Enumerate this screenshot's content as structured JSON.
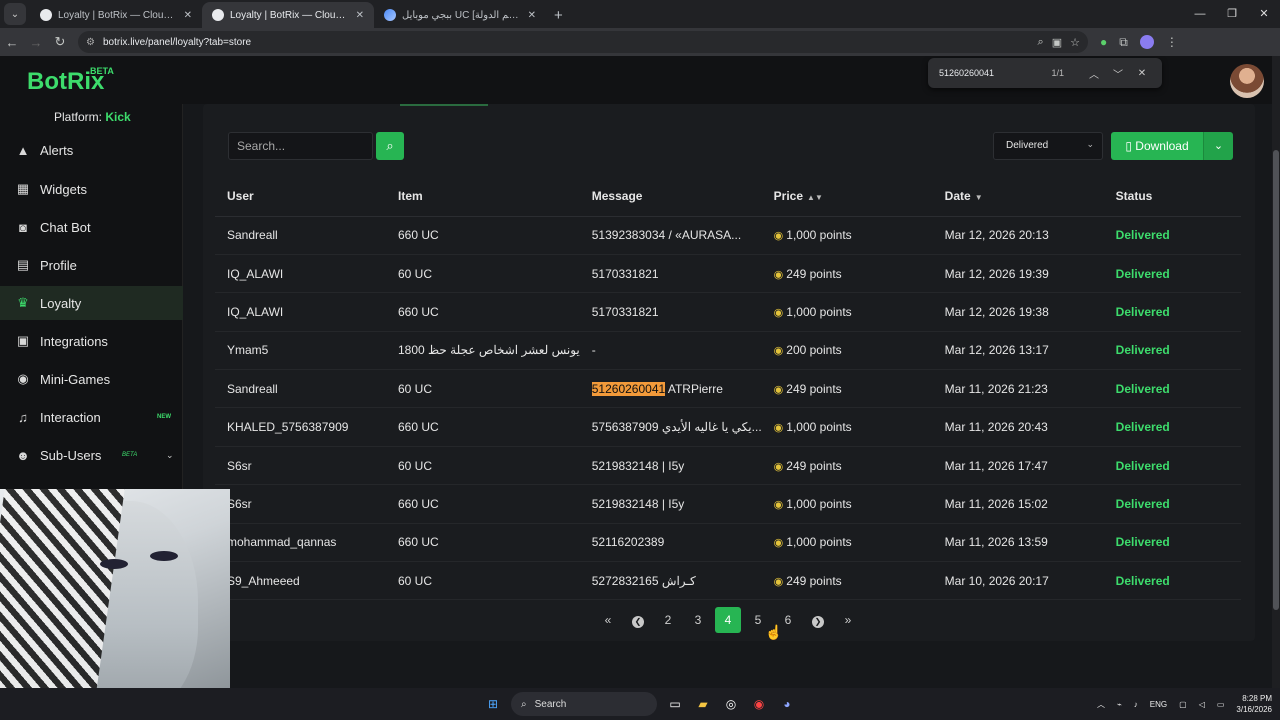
{
  "browser": {
    "tabs": [
      {
        "title": "Loyalty | BotRix — Cloud Stream",
        "active": false
      },
      {
        "title": "Loyalty | BotRix — Cloud Stream",
        "active": true
      },
      {
        "title": "ببجي موبايل UC [اسم الدولة] | خـ",
        "active": false
      }
    ],
    "url": "botrix.live/panel/loyalty?tab=store",
    "find": {
      "query": "51260260041",
      "count": "1/1"
    }
  },
  "app": {
    "logo": "BotRix",
    "logo_badge": "BETA",
    "platform_label": "Platform:",
    "platform_value": "Kick"
  },
  "sidebar": {
    "items": [
      {
        "label": "Alerts",
        "icon": "warning-icon"
      },
      {
        "label": "Widgets",
        "icon": "grid-icon"
      },
      {
        "label": "Chat Bot",
        "icon": "robot-icon"
      },
      {
        "label": "Profile",
        "icon": "id-card-icon"
      },
      {
        "label": "Loyalty",
        "icon": "trophy-icon"
      },
      {
        "label": "Integrations",
        "icon": "plug-icon"
      },
      {
        "label": "Mini-Games",
        "icon": "gamepad-icon"
      },
      {
        "label": "Interaction",
        "icon": "music-icon",
        "badge": "NEW"
      },
      {
        "label": "Sub-Users",
        "icon": "users-icon",
        "badge": "BETA"
      }
    ]
  },
  "toolbar": {
    "search_placeholder": "Search...",
    "status_value": "Delivered",
    "download_label": "Download"
  },
  "table": {
    "headers": [
      "User",
      "Item",
      "Message",
      "Price",
      "Date",
      "Status"
    ],
    "rows": [
      {
        "user": "Sandreall",
        "item": "660 UC",
        "message": "51392383034 / «AURASA...",
        "price": "1,000 points",
        "date": "Mar 12, 2026 20:13",
        "status": "Delivered"
      },
      {
        "user": "IQ_ALAWI",
        "item": "60 UC",
        "message": "5170331821",
        "price": "249 points",
        "date": "Mar 12, 2026 19:39",
        "status": "Delivered"
      },
      {
        "user": "IQ_ALAWI",
        "item": "660 UC",
        "message": "5170331821",
        "price": "1,000 points",
        "date": "Mar 12, 2026 19:38",
        "status": "Delivered"
      },
      {
        "user": "Ymam5",
        "item": "يونس لعشر اشخاص عجلة حظ 1800",
        "message": "-",
        "price": "200 points",
        "date": "Mar 12, 2026 13:17",
        "status": "Delivered"
      },
      {
        "user": "Sandreall",
        "item": "60 UC",
        "message_hl": "51260260041",
        "message": " ATRPierre",
        "price": "249 points",
        "date": "Mar 11, 2026 21:23",
        "status": "Delivered"
      },
      {
        "user": "KHALED_5756387909",
        "item": "660 UC",
        "message": "5756387909 يكي يا غاليه الأيدي...",
        "price": "1,000 points",
        "date": "Mar 11, 2026 20:43",
        "status": "Delivered"
      },
      {
        "user": "S6sr",
        "item": "60 UC",
        "message": "5219832148 | I5y",
        "price": "249 points",
        "date": "Mar 11, 2026 17:47",
        "status": "Delivered"
      },
      {
        "user": "S6sr",
        "item": "660 UC",
        "message": "5219832148 | I5y",
        "price": "1,000 points",
        "date": "Mar 11, 2026 15:02",
        "status": "Delivered"
      },
      {
        "user": "mohammad_qannas",
        "item": "660 UC",
        "message": "52116202389",
        "price": "1,000 points",
        "date": "Mar 11, 2026 13:59",
        "status": "Delivered"
      },
      {
        "user": "S9_Ahmeeed",
        "item": "60 UC",
        "message": "5272832165 كـراش",
        "price": "249 points",
        "date": "Mar 10, 2026 20:17",
        "status": "Delivered"
      }
    ]
  },
  "pagination": {
    "pages": [
      "2",
      "3",
      "4",
      "5",
      "6"
    ],
    "current": "4"
  },
  "taskbar": {
    "search_label": "Search",
    "lang": "ENG",
    "time": "8:28 PM",
    "date": "3/16/2026"
  },
  "colors": {
    "accent": "#27b553",
    "status": "#3ddc6c",
    "highlight": "#f29a3a"
  }
}
